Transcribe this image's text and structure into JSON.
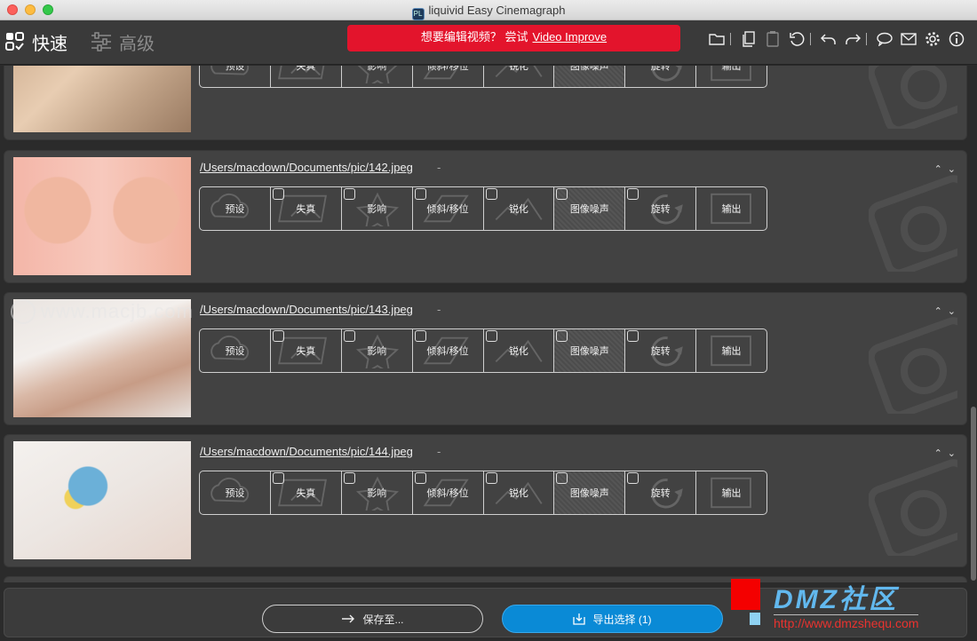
{
  "window": {
    "title": "liquivid Easy Cinemagraph",
    "app_icon": "PL"
  },
  "toolbar": {
    "quick_label": "快速",
    "advanced_label": "高级",
    "promo_text": "想要编辑视频？ 尝试",
    "promo_link": "Video Improve",
    "promo_color": "#e3142c",
    "icons": [
      "folder-icon",
      "copy-icon",
      "paste-icon",
      "reset-icon",
      "undo-icon",
      "redo-icon",
      "chat-icon",
      "mail-icon",
      "settings-icon",
      "info-icon"
    ]
  },
  "steps": [
    "预设",
    "失真",
    "影响",
    "倾斜/移位",
    "锐化",
    "图像噪声",
    "旋转",
    "输出"
  ],
  "items": [
    {
      "path": "",
      "dash": ""
    },
    {
      "path": "/Users/macdown/Documents/pic/142.jpeg",
      "dash": "-"
    },
    {
      "path": "/Users/macdown/Documents/pic/143.jpeg",
      "dash": "-"
    },
    {
      "path": "/Users/macdown/Documents/pic/144.jpeg",
      "dash": "-"
    }
  ],
  "footer": {
    "save_label": "保存至...",
    "export_label": "导出选择 (1)",
    "export_color": "#0a8ad6"
  },
  "watermarks": {
    "macjb": "www.macjb.com",
    "dmz_big": "DMZ社区",
    "dmz_url": "http://www.dmzshequ.com"
  }
}
